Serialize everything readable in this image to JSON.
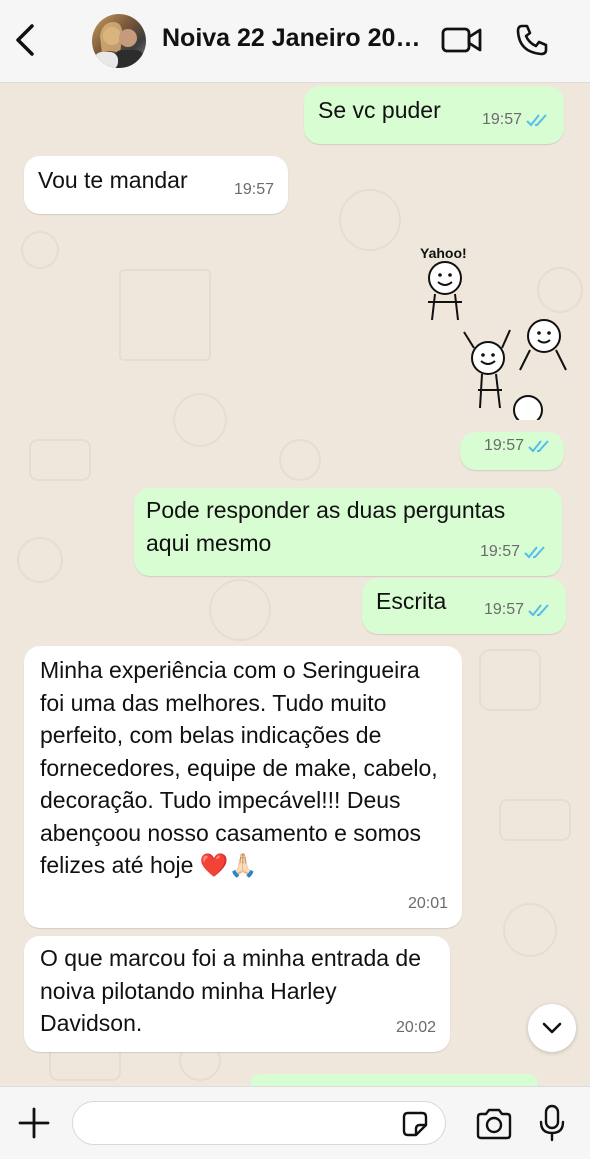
{
  "header": {
    "title": "Noiva 22 Janeiro 202...",
    "icons": [
      "chevron-left-icon",
      "avatar",
      "video-camera-icon",
      "phone-icon"
    ]
  },
  "messages": [
    {
      "direction": "out",
      "text": "Se vc puder",
      "time": "19:57",
      "status": "read"
    },
    {
      "direction": "in",
      "text": "Vou te mandar",
      "time": "19:57"
    },
    {
      "direction": "out",
      "type": "sticker",
      "sticker_text": "Yahoo!",
      "time": "19:57",
      "status": "read"
    },
    {
      "direction": "out",
      "text": "Pode responder as duas perguntas aqui mesmo",
      "time": "19:57",
      "status": "read"
    },
    {
      "direction": "out",
      "text": "Escrita",
      "time": "19:57",
      "status": "read"
    },
    {
      "direction": "in",
      "text": "Minha experiência com o Seringueira foi uma das melhores. Tudo muito perfeito, com belas indicações de fornecedores, equipe de make, cabelo, decoração. Tudo impecável!!! Deus abençoou nosso casamento e somos felizes até hoje ❤️🙏🏻",
      "time": "20:01"
    },
    {
      "direction": "in",
      "text": "O que marcou foi a minha entrada de noiva pilotando minha Harley Davidson.",
      "time": "20:02"
    }
  ],
  "colors": {
    "outgoing_bubble": "#d9fdd3",
    "incoming_bubble": "#ffffff",
    "read_ticks": "#53bdeb",
    "chat_background": "#efe7dc"
  },
  "input_bar": {
    "placeholder": "",
    "icons": [
      "plus-icon",
      "sticker-icon",
      "camera-icon",
      "microphone-icon"
    ]
  }
}
